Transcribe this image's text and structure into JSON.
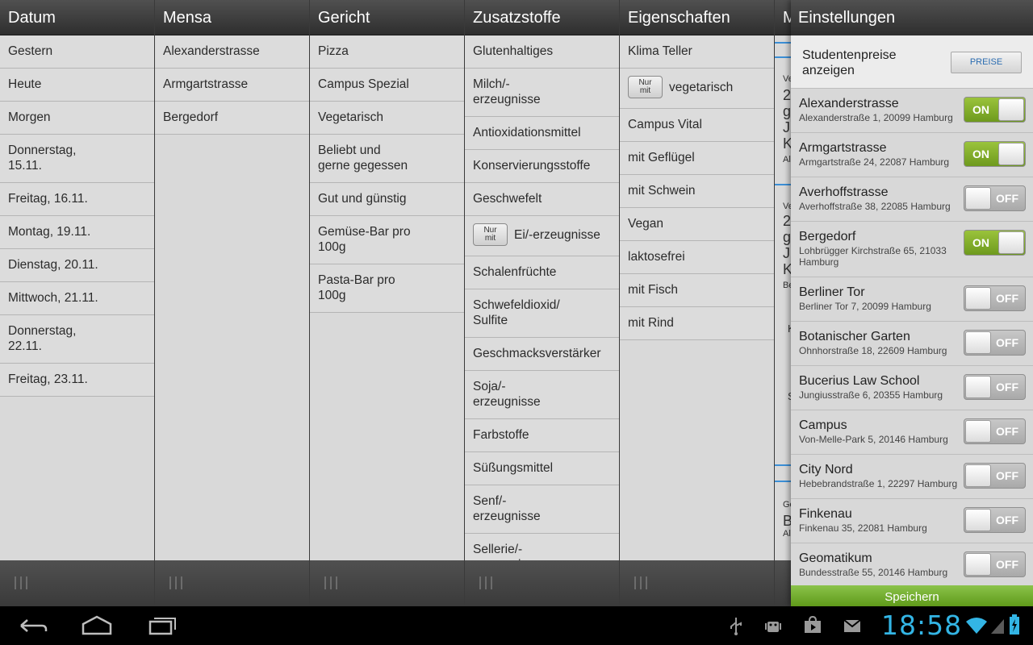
{
  "columns": [
    {
      "title": "Datum",
      "items": [
        "Gestern",
        "Heute",
        "Morgen",
        "Donnerstag,\n15.11.",
        "Freitag, 16.11.",
        "Montag, 19.11.",
        "Dienstag, 20.11.",
        "Mittwoch, 21.11.",
        "Donnerstag,\n22.11.",
        "Freitag, 23.11."
      ]
    },
    {
      "title": "Mensa",
      "items": [
        "Alexanderstrasse",
        "Armgartstrasse",
        "Bergedorf"
      ]
    },
    {
      "title": "Gericht",
      "items": [
        "Pizza",
        "Campus Spezial",
        "Vegetarisch",
        "Beliebt und\ngerne gegessen",
        "Gut und günstig",
        "Gemüse-Bar pro\n100g",
        "Pasta-Bar pro\n100g"
      ]
    },
    {
      "title": "Zusatzstoffe",
      "items": [
        "Glutenhaltiges",
        "Milch/-\nerzeugnisse",
        "Antioxidationsmittel",
        "Konservierungsstoffe",
        "Geschwefelt",
        "Ei/-erzeugnisse",
        "Schalenfrüchte",
        "Schwefeldioxid/\nSulfite",
        "Geschmacksverstärker",
        "Soja/-\nerzeugnisse",
        "Farbstoffe",
        "Süßungsmittel",
        "Senf/-\nerzeugnisse",
        "Sellerie/-\nerzeugnisse"
      ]
    },
    {
      "title": "Eigenschaften",
      "items": [
        "Klima Teller",
        "vegetarisch",
        "Campus Vital",
        "mit Geflügel",
        "mit Schwein",
        "Vegan",
        "laktosefrei",
        "mit Fisch",
        "mit Rind"
      ]
    }
  ],
  "nur_mit_label": "Nur\nmit",
  "col6": {
    "title": "M",
    "fragments": [
      "Ve",
      "2",
      "g",
      "J",
      "K",
      "Al",
      "Ve",
      "2",
      "g",
      "J",
      "K",
      "Be",
      "K",
      "S",
      "Ge",
      "B",
      "Al"
    ]
  },
  "settings": {
    "title": "Einstellungen",
    "prices_label": "Studentenpreise\nanzeigen",
    "prices_button": "PREISE",
    "on_label": "ON",
    "off_label": "OFF",
    "mensas": [
      {
        "name": "Alexanderstrasse",
        "address": "Alexanderstraße 1, 20099 Hamburg",
        "enabled": true
      },
      {
        "name": "Armgartstrasse",
        "address": "Armgartstraße 24, 22087 Hamburg",
        "enabled": true
      },
      {
        "name": "Averhoffstrasse",
        "address": "Averhoffstraße 38, 22085 Hamburg",
        "enabled": false
      },
      {
        "name": "Bergedorf",
        "address": "Lohbrügger Kirchstraße 65, 21033 Hamburg",
        "enabled": true
      },
      {
        "name": "Berliner Tor",
        "address": "Berliner Tor 7, 20099 Hamburg",
        "enabled": false
      },
      {
        "name": "Botanischer Garten",
        "address": "Ohnhorstraße 18, 22609 Hamburg",
        "enabled": false
      },
      {
        "name": "Bucerius Law School",
        "address": "Jungiusstraße 6, 20355 Hamburg",
        "enabled": false
      },
      {
        "name": "Campus",
        "address": "Von-Melle-Park 5, 20146 Hamburg",
        "enabled": false
      },
      {
        "name": "City Nord",
        "address": "Hebebrandstraße 1, 22297 Hamburg",
        "enabled": false
      },
      {
        "name": "Finkenau",
        "address": "Finkenau 35, 22081 Hamburg",
        "enabled": false
      },
      {
        "name": "Geomatikum",
        "address": "Bundesstraße 55, 20146 Hamburg",
        "enabled": false
      }
    ],
    "save_label": "Speichern"
  },
  "system": {
    "clock": "18:58",
    "icons": [
      "back-icon",
      "home-icon",
      "recent-apps-icon",
      "usb-icon",
      "android-debug-icon",
      "store-icon",
      "gmail-icon",
      "wifi-icon",
      "signal-icon",
      "battery-icon"
    ],
    "accent_color": "#33b5e5"
  }
}
